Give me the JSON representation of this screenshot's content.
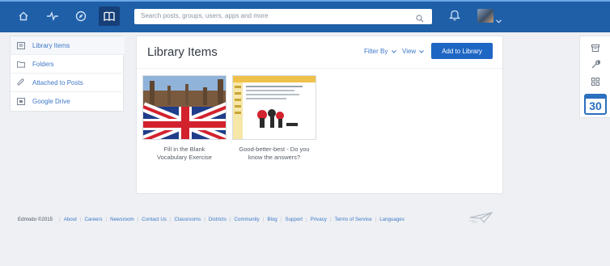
{
  "topbar": {
    "nav": [
      {
        "name": "home-icon"
      },
      {
        "name": "activity-icon"
      },
      {
        "name": "compass-icon"
      },
      {
        "name": "book-icon"
      }
    ],
    "search_placeholder": "Search posts, groups, users, apps and more",
    "colors": {
      "bar": "#1e5fa8",
      "active": "#173f78"
    }
  },
  "sidebar": {
    "items": [
      {
        "label": "Library Items",
        "icon": "library-icon"
      },
      {
        "label": "Folders",
        "icon": "folder-icon"
      },
      {
        "label": "Attached to Posts",
        "icon": "paperclip-icon"
      },
      {
        "label": "Google Drive",
        "icon": "drive-icon"
      }
    ]
  },
  "main": {
    "title": "Library Items",
    "filter_label": "Filter By",
    "view_label": "View",
    "add_button": "Add to Library",
    "items": [
      {
        "caption_line1": "Fill in the Blank",
        "caption_line2": "Vocabulary Exercise"
      },
      {
        "caption_line1": "Good-better-best - Do you",
        "caption_line2": "know the answers?"
      }
    ]
  },
  "rail": {
    "calendar_day": "30"
  },
  "footer": {
    "copyright": "Edmodo ©2015",
    "links": [
      "About",
      "Careers",
      "Newsroom",
      "Contact Us",
      "Classrooms",
      "Districts",
      "Community",
      "Blog",
      "Support",
      "Privacy",
      "Terms of Service",
      "Languages"
    ]
  }
}
